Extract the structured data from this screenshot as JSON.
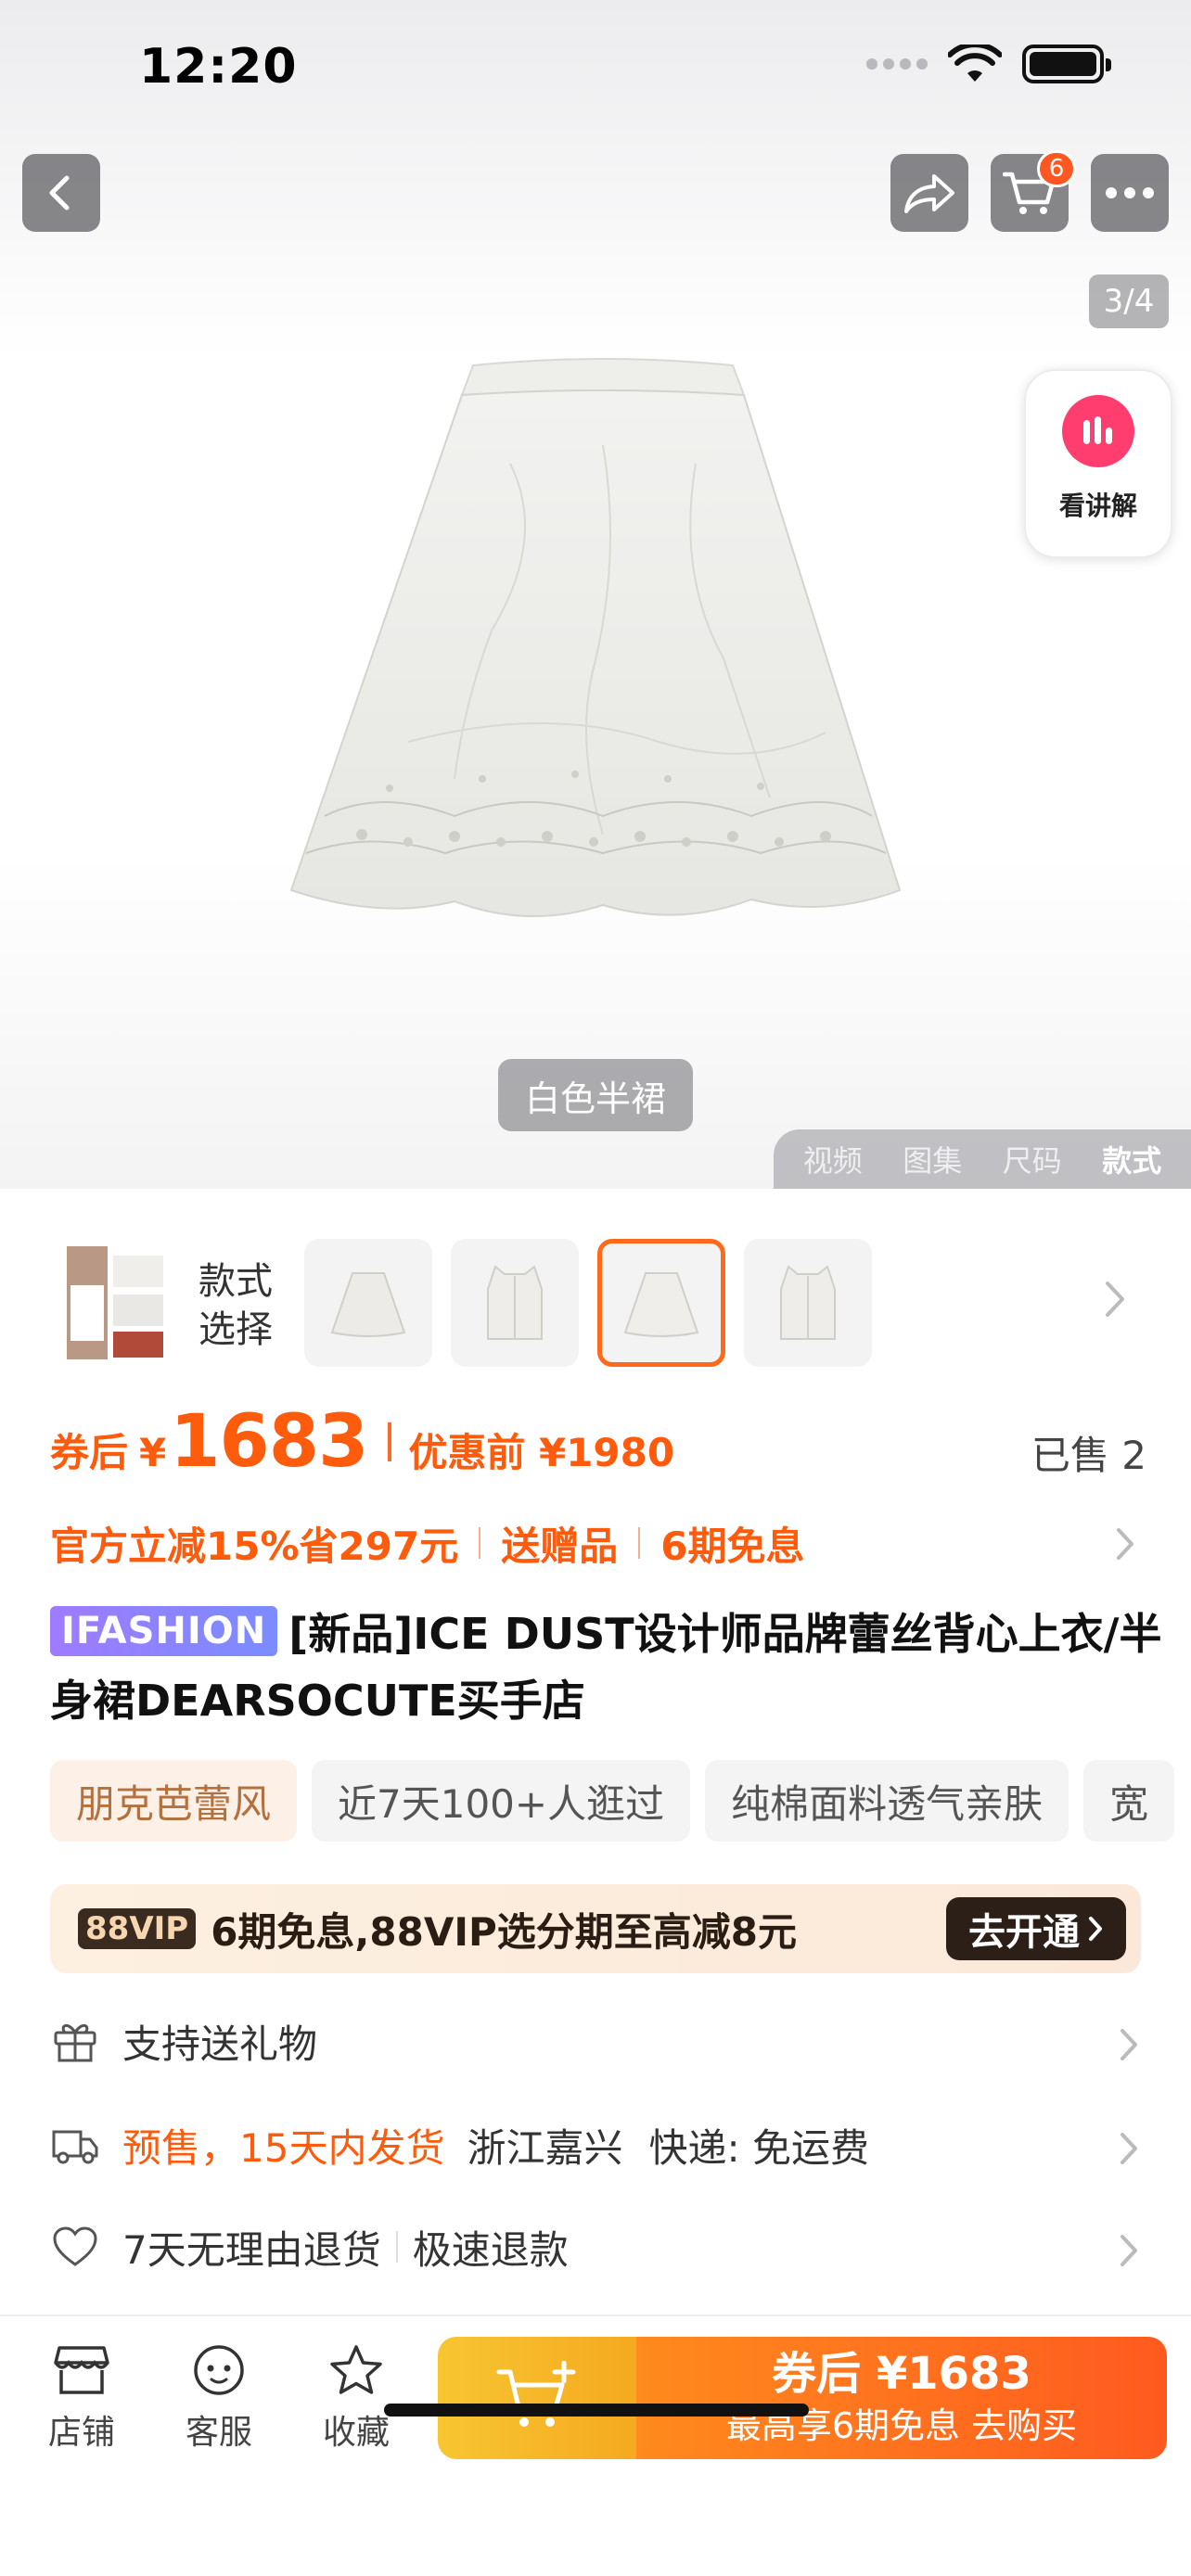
{
  "status_bar": {
    "time": "12:20"
  },
  "nav": {
    "cart_count": "6"
  },
  "gallery": {
    "counter": "3/4",
    "explain_label": "看讲解",
    "caption": "白色半裙",
    "tabs": [
      "视频",
      "图集",
      "尺码",
      "款式"
    ],
    "active_tab": "款式"
  },
  "variants": {
    "title": "款式选择"
  },
  "price": {
    "prefix": "券后",
    "yen": "¥",
    "amount": "1683",
    "original_label": "优惠前 ¥1980",
    "sold": "已售 2"
  },
  "promos": [
    "官方立减15%省297元",
    "送赠品",
    "6期免息"
  ],
  "product": {
    "brand_tag": "IFASHION",
    "title": "[新品]ICE DUST设计师品牌蕾丝背心上衣/半身裙DEARSOCUTE买手店"
  },
  "tags": [
    "朋克芭蕾风",
    "近7天100+人逛过",
    "纯棉面料透气亲肤",
    "宽"
  ],
  "vip": {
    "badge": "88VIP",
    "text": "6期免息,88VIP选分期至高减8元",
    "cta": "去开通"
  },
  "info": {
    "gift": "支持送礼物",
    "presale": "预售，15天内发货",
    "location": "浙江嘉兴",
    "shipping": "快递: 免运费",
    "returns": "7天无理由退货",
    "refund": "极速退款"
  },
  "bottom": {
    "store": "店铺",
    "service": "客服",
    "favorite": "收藏",
    "buy_line1": "券后 ¥1683",
    "buy_line2": "最高享6期免息 去购买"
  },
  "colors": {
    "accent": "#ff5b0d",
    "vip_dark": "#2b1f18",
    "cart_yellow": "#f7c631"
  }
}
